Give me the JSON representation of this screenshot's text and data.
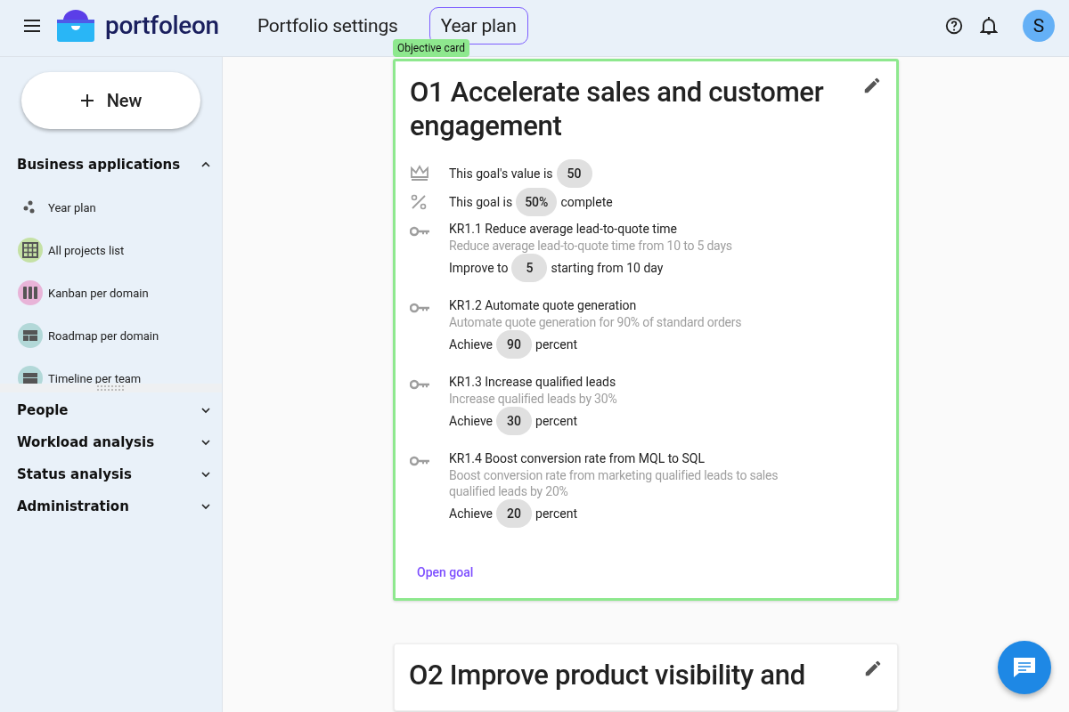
{
  "header": {
    "brand": "portfoleon",
    "nav": [
      {
        "label": "Portfolio settings",
        "selected": false
      },
      {
        "label": "Year plan",
        "selected": true
      }
    ],
    "avatar": "S"
  },
  "sidebar": {
    "new_button": "New",
    "sections": [
      {
        "label": "Business applications",
        "expanded": true,
        "items": [
          {
            "label": "Year plan",
            "kind": "dots"
          },
          {
            "label": "All projects list",
            "kind": "grid",
            "color": "#c5e1a5"
          },
          {
            "label": "Kanban per domain",
            "kind": "columns",
            "color": "#e8b4d8"
          },
          {
            "label": "Roadmap per domain",
            "kind": "roadmap",
            "color": "#b2d8d8"
          },
          {
            "label": "Timeline per team",
            "kind": "timeline",
            "color": "#b2d8d8"
          }
        ]
      },
      {
        "label": "People",
        "expanded": false
      },
      {
        "label": "Workload analysis",
        "expanded": false
      },
      {
        "label": "Status analysis",
        "expanded": false
      },
      {
        "label": "Administration",
        "expanded": false
      }
    ]
  },
  "cards": [
    {
      "tag": "Objective card",
      "highlighted": true,
      "title": "O1 Accelerate sales and customer engagement",
      "value": {
        "before": "This goal's value is",
        "chip": "50"
      },
      "progress": {
        "before": "This goal is",
        "chip": "50%",
        "after": "complete"
      },
      "key_results": [
        {
          "title": "KR1.1 Reduce average lead-to-quote time",
          "description": "Reduce average lead-to-quote time from 10 to 5 days",
          "before": "Improve to",
          "chip": "5",
          "after": "starting from 10 day"
        },
        {
          "title": "KR1.2 Automate quote generation",
          "description": "Automate quote generation for 90% of standard orders",
          "before": "Achieve",
          "chip": "90",
          "after": "percent"
        },
        {
          "title": "KR1.3 Increase qualified leads",
          "description": "Increase qualified leads by 30%",
          "before": "Achieve",
          "chip": "30",
          "after": "percent"
        },
        {
          "title": "KR1.4 Boost conversion rate from MQL to SQL",
          "description": "Boost conversion rate from marketing qualified leads to sales qualified leads by 20%",
          "before": "Achieve",
          "chip": "20",
          "after": "percent"
        }
      ],
      "link": "Open goal"
    },
    {
      "highlighted": false,
      "title": "O2 Improve product visibility and"
    }
  ]
}
